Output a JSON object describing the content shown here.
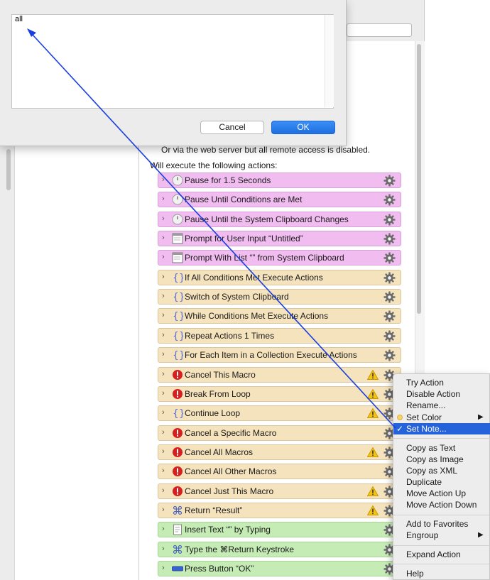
{
  "window": {
    "remote_text": "Or via the web server but all remote access is disabled.",
    "will_execute": "Will execute the following actions:"
  },
  "actions": [
    {
      "label": "Pause for 1.5 Seconds",
      "color": "pink",
      "icon": "clock-icon",
      "warn": false
    },
    {
      "label": "Pause Until Conditions are Met",
      "color": "pink",
      "icon": "clock-icon",
      "warn": false
    },
    {
      "label": "Pause Until the System Clipboard Changes",
      "color": "pink",
      "icon": "clock-icon",
      "warn": false
    },
    {
      "label": "Prompt for User Input “Untitled”",
      "color": "pink",
      "icon": "window-icon",
      "warn": false
    },
    {
      "label": "Prompt With List “” from System Clipboard",
      "color": "pink",
      "icon": "window-icon",
      "warn": false
    },
    {
      "label": "If All Conditions Met Execute Actions",
      "color": "tan",
      "icon": "braces-icon",
      "warn": false
    },
    {
      "label": "Switch of System Clipboard",
      "color": "tan",
      "icon": "braces-icon",
      "warn": false
    },
    {
      "label": "While Conditions Met Execute Actions",
      "color": "tan",
      "icon": "braces-icon",
      "warn": false
    },
    {
      "label": "Repeat Actions 1 Times",
      "color": "tan",
      "icon": "braces-icon",
      "warn": false
    },
    {
      "label": "For Each Item in a Collection Execute Actions",
      "color": "tan",
      "icon": "braces-icon",
      "warn": false
    },
    {
      "label": "Cancel This Macro",
      "color": "tan",
      "icon": "stop-icon",
      "warn": true
    },
    {
      "label": "Break From Loop",
      "color": "tan",
      "icon": "stop-icon",
      "warn": true
    },
    {
      "label": "Continue Loop",
      "color": "tan",
      "icon": "braces-icon",
      "warn": true
    },
    {
      "label": "Cancel a Specific Macro",
      "color": "tan",
      "icon": "stop-icon",
      "warn": false
    },
    {
      "label": "Cancel All Macros",
      "color": "tan",
      "icon": "stop-icon",
      "warn": true
    },
    {
      "label": "Cancel All Other Macros",
      "color": "tan",
      "icon": "stop-icon",
      "warn": false
    },
    {
      "label": "Cancel Just This Macro",
      "color": "tan",
      "icon": "stop-icon",
      "warn": true
    },
    {
      "label": "Return “Result”",
      "color": "tan",
      "icon": "command-icon",
      "warn": true
    },
    {
      "label": "Insert Text “” by Typing",
      "color": "green",
      "icon": "document-icon",
      "warn": false
    },
    {
      "label": "Type the ⌘Return Keystroke",
      "color": "green",
      "icon": "command-icon",
      "warn": false
    },
    {
      "label": "Press Button “OK”",
      "color": "green",
      "icon": "button-icon",
      "warn": false
    }
  ],
  "dialog": {
    "note_text": "all",
    "cancel_label": "Cancel",
    "ok_label": "OK"
  },
  "context_menu": {
    "groups": [
      [
        "Try Action",
        "Disable Action",
        "Rename...",
        "Set Color",
        "Set Note..."
      ],
      [
        "Copy as Text",
        "Copy as Image",
        "Copy as XML",
        "Duplicate",
        "Move Action Up",
        "Move Action Down"
      ],
      [
        "Add to Favorites",
        "Engroup"
      ],
      [
        "Expand Action"
      ],
      [
        "Help"
      ]
    ],
    "selected": "Set Note...",
    "submenus": [
      "Set Color",
      "Engroup"
    ]
  },
  "colors": {
    "pink": "#f1bdf0",
    "tan": "#f5e3bd",
    "green": "#c6ecb6",
    "selection": "#2463d9",
    "arrow": "#1a3fe0"
  }
}
